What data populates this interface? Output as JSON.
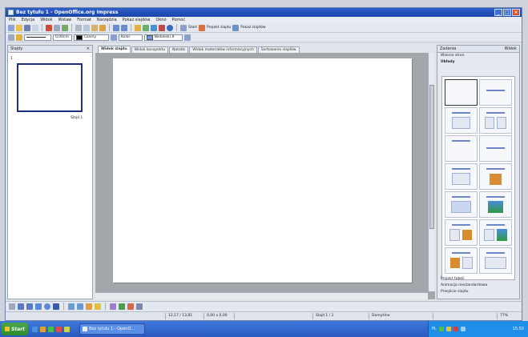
{
  "window": {
    "title": "Bez tytułu 1 - OpenOffice.org Impress",
    "controls": [
      "_",
      "□",
      "×"
    ]
  },
  "menu": [
    "Plik",
    "Edycja",
    "Widok",
    "Wstaw",
    "Format",
    "Narzędzia",
    "Pokaz slajdów",
    "Okno",
    "Pomoc"
  ],
  "toolbar1": {
    "start_label": "Start",
    "design_label": "Projekt slajdu",
    "show_label": "Pokaz slajdów"
  },
  "toolbar2": {
    "line_width": "0,00cm",
    "color_label": "Czarny",
    "fill_type": "Kolor",
    "fill_value": "Niebieski 8"
  },
  "slides_pane": {
    "title": "Slajdy",
    "close": "×",
    "slide_number": "1",
    "slide_caption": "Slajd 1"
  },
  "tabs": [
    "Widok slajdu",
    "Widok konspektu",
    "Notatki",
    "Widok materiałów informacyjnych",
    "Sortowanie slajdów"
  ],
  "tasks_pane": {
    "title": "Zadania",
    "view_label": "Widok",
    "links": [
      "Wzorce stron",
      "Układy"
    ],
    "bottom_links": [
      "Projekt tabeli",
      "Animacja niestandardowa",
      "Przejście slajdu"
    ]
  },
  "status": {
    "position": "12,17 / 13,81",
    "size": "0,00 x 0,00",
    "slide": "Slajd 1 / 1",
    "design": "Domyślne",
    "zoom": "77%"
  },
  "taskbar": {
    "start": "Start",
    "task_item": "Bez tytułu 1 - OpenO...",
    "lang": "PL",
    "time": "15:50"
  }
}
